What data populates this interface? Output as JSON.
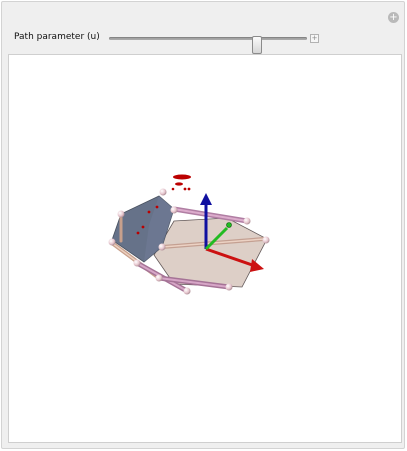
{
  "controls": {
    "path_parameter_label": "Path parameter (u)",
    "slider_value_fraction": 0.76
  },
  "icons": {
    "corner_plus": "add-circle-icon",
    "expand": "plus-square-icon"
  },
  "colors": {
    "panel_bg": "#efefef",
    "x_axis": "#cc1111",
    "y_axis": "#22bb22",
    "z_axis": "#1111aa",
    "tan_plate": "#d8c9c0",
    "slate_plate": "#5e6b85",
    "strut": "#c890b8",
    "marker": "#bb0000"
  }
}
